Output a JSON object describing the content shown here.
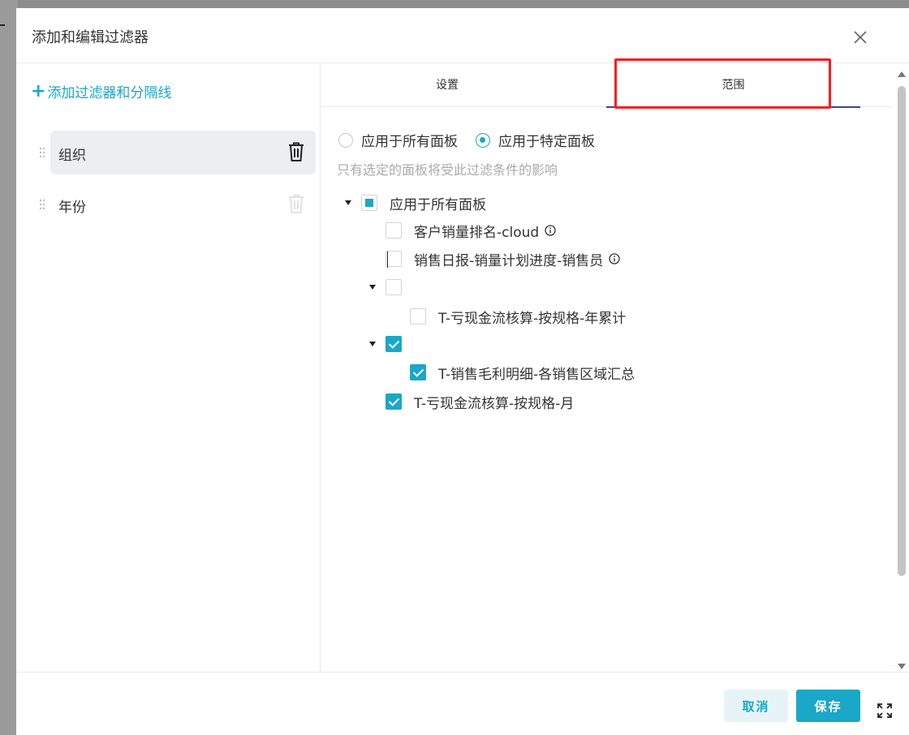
{
  "dialog": {
    "title": "添加和编辑过滤器",
    "close_icon": "close-icon"
  },
  "left_panel": {
    "add_link": {
      "icon": "plus-icon",
      "label": "添加过滤器和分隔线"
    },
    "filters": [
      {
        "label": "组织",
        "active": true
      },
      {
        "label": "年份",
        "active": false
      }
    ]
  },
  "tabs": [
    {
      "label": "设置",
      "active": false
    },
    {
      "label": "范围",
      "active": true
    }
  ],
  "scope": {
    "radio_all": {
      "label": "应用于所有面板",
      "checked": false
    },
    "radio_specific": {
      "label": "应用于特定面板",
      "checked": true
    },
    "hint": "只有选定的面板将受此过滤条件的影响",
    "tree": {
      "root": {
        "label": "应用于所有面板",
        "state": "indeterminate",
        "expanded": true
      },
      "items": [
        {
          "label": "客户销量排名-cloud",
          "checked": false,
          "info": true
        },
        {
          "label": "销售日报-销量计划进度-销售员",
          "checked": false,
          "info": true
        },
        {
          "label": "",
          "checked": false,
          "group": true
        },
        {
          "label": "T-亏现金流核算-按规格-年累计",
          "checked": false
        },
        {
          "label": "",
          "checked": true,
          "group": true
        },
        {
          "label": "T-销售毛利明细-各销售区域汇总",
          "checked": true
        },
        {
          "label": "T-亏现金流核算-按规格-月",
          "checked": true
        }
      ]
    }
  },
  "footer": {
    "cancel_label": "取消",
    "save_label": "保存",
    "fullscreen_icon": "expand-icon"
  },
  "colors": {
    "accent": "#1aa7c8",
    "highlight": "#ff1a1a",
    "tab_underline": "#3a4a8a"
  }
}
